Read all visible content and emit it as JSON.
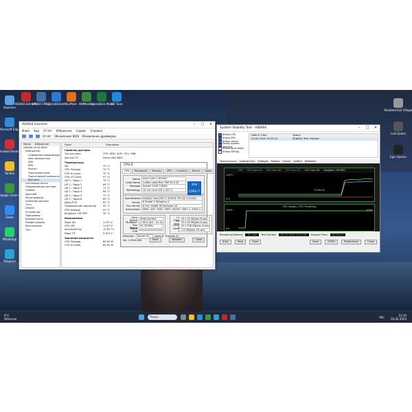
{
  "desktop": {
    "icons_left": [
      {
        "label": "Корзина",
        "color": "#5aa0e8"
      },
      {
        "label": "Microsoft Edge",
        "color": "#2e8fd6"
      },
      {
        "label": "Acrobat Reader",
        "color": "#d32f2f"
      },
      {
        "label": "Yandex",
        "color": "#f0c020"
      },
      {
        "label": "Google Chrome",
        "color": "#3c9a3c"
      },
      {
        "label": "Zoom",
        "color": "#2d8cff"
      },
      {
        "label": "WhatsApp",
        "color": "#25d366"
      },
      {
        "label": "Telegram",
        "color": "#2aa3d8"
      }
    ],
    "icons_top": [
      {
        "label": "AIDA64 Extreme",
        "color": "#c62828"
      },
      {
        "label": "CPUID CPU-Z",
        "color": "#4a6fa5"
      },
      {
        "label": "CrystalDiskInfo",
        "color": "#2b7bd6"
      },
      {
        "label": "FurMark",
        "color": "#e07020"
      },
      {
        "label": "HWMonitor",
        "color": "#3a8a3a"
      },
      {
        "label": "CrystalDisk Mark",
        "color": "#1b7a3e"
      },
      {
        "label": "HD Tune",
        "color": "#1e88e5"
      }
    ],
    "icons_right": [
      {
        "label": "Resident Evil Village",
        "color": "#999999"
      },
      {
        "label": "Last Epoch",
        "color": "#555555"
      },
      {
        "label": "Epic Games",
        "color": "#222222"
      }
    ]
  },
  "aida": {
    "title": "AIDA64 Extreme",
    "menu": [
      "Файл",
      "Вид",
      "Отчёт",
      "Избранное",
      "Сервис",
      "Справка"
    ],
    "toolbar": [
      "Отчёт",
      "Обновления BIOS",
      "Обновление драйверов"
    ],
    "tree_header": [
      "Меню",
      "Избранное"
    ],
    "tree": [
      "AIDA64 v6.92.6600",
      "Компьютер",
      "Суммарная информация",
      "Имя компьютера",
      "DMI",
      "IPMI",
      "Разгон",
      "Электропитание",
      "Портативный компьютер",
      "Датчики",
      "Системная плата",
      "Операционная система",
      "Сервер",
      "Дисплей",
      "Мультимедиа",
      "Хранение данных",
      "Сеть",
      "DirectX",
      "Устройства",
      "Программы",
      "Безопасность",
      "Конфигурация",
      "База данных",
      "Тест"
    ],
    "columns": [
      "Поле",
      "Значение"
    ],
    "rows": [
      {
        "k": "Свойства датчика",
        "v": "",
        "sec": true
      },
      {
        "k": "Тип датчика",
        "v": "CPU, HDD, ACPI, PCH, SNB"
      },
      {
        "k": "Датчик ГП",
        "v": "Driver (NV-DRV)"
      },
      {
        "k": "Температуры",
        "v": "",
        "sec": true
      },
      {
        "k": "ЦП",
        "v": "75 °C"
      },
      {
        "k": "CPU Package",
        "v": "75 °C"
      },
      {
        "k": "CPU IA Cores",
        "v": "75 °C"
      },
      {
        "k": "CPU GT Cores",
        "v": "57 °C"
      },
      {
        "k": "ЦП 1 / Ядро 1",
        "v": "75 °C"
      },
      {
        "k": "ЦП 1 / Ядро 2",
        "v": "69 °C"
      },
      {
        "k": "ЦП 1 / Ядро 3",
        "v": "71 °C"
      },
      {
        "k": "ЦП 1 / Ядро 4",
        "v": "64 °C"
      },
      {
        "k": "ЦП 1 / Ядро 5",
        "v": "71 °C"
      },
      {
        "k": "ЦП 1 / Ядро 6",
        "v": "69 °C"
      },
      {
        "k": "Диод PCH",
        "v": "62 °C"
      },
      {
        "k": "Графический процессор",
        "v": "45 °C"
      },
      {
        "k": "GPU Hotspot",
        "v": "53 °C"
      },
      {
        "k": "KingSpec 1TB PRO",
        "v": "30 °C"
      },
      {
        "k": "Напряжения",
        "v": "",
        "sec": true
      },
      {
        "k": "Ядро ЦП",
        "v": "1.007 V"
      },
      {
        "k": "CPU VID",
        "v": "1.007 V"
      },
      {
        "k": "Аккумулятор",
        "v": "12.877 V"
      },
      {
        "k": "Ядро ГП",
        "v": "0.613 V"
      },
      {
        "k": "Значения мощности",
        "v": "",
        "sec": true
      },
      {
        "k": "CPU Package",
        "v": "89.00 W"
      },
      {
        "k": "CPU IA Cores",
        "v": "85.92 W"
      }
    ]
  },
  "cpuz": {
    "title": "CPU-Z",
    "tabs": [
      "CPU",
      "Mainboard",
      "Memory",
      "SPD",
      "Graphics",
      "Bench",
      "About"
    ],
    "processor": [
      {
        "l": "Name",
        "v": "Intel Core i7 8750H"
      },
      {
        "l": "Code Name",
        "v": "Coffee Lake   Max TDP 45.0 W"
      },
      {
        "l": "Package",
        "v": "Socket 1440 FCBGA"
      },
      {
        "l": "Technology",
        "v": "14 nm   Core VID 1.007 V"
      }
    ],
    "spec": "Intel(R) Core(TM) i7-8750H CPU @ 2.20GHz",
    "family": [
      {
        "l": "Family",
        "v": "6   Model 9   Stepping A"
      },
      {
        "l": "Ext. Family",
        "v": "6   Ext. Model 9E   Revision U0"
      },
      {
        "l": "Instructions",
        "v": "MMX, SSE, SSE2, SSE3, SSSE3, SSE4.1, SSE4.2, EM64T, VT-x, AES, AVX, AVX2, FMA3"
      }
    ],
    "clocks": [
      {
        "l": "Core Speed",
        "v": "3585.48 MHz"
      },
      {
        "l": "Multiplier",
        "v": "x 36.0 (8.0 - 41.0)"
      },
      {
        "l": "Bus Speed",
        "v": "99.78 MHz"
      },
      {
        "l": "Rated FSB",
        "v": ""
      }
    ],
    "cache": [
      {
        "l": "L1 Data",
        "v": "6 x 32 KBytes   8-way"
      },
      {
        "l": "L1 Inst.",
        "v": "6 x 32 KBytes   8-way"
      },
      {
        "l": "Level 2",
        "v": "6 x 256 KBytes   4-way"
      },
      {
        "l": "Level 3",
        "v": "12 MBytes   16-way"
      }
    ],
    "selection": "Socket #1",
    "cores": "Cores 6",
    "threads": "Threads 12",
    "version": "Ver. 2.08.0.x64",
    "tools": "Tools",
    "validate": "Validate",
    "close": "Close",
    "intel_badge": "intel CORE i7"
  },
  "sst": {
    "title": "System Stability Test - AIDA64",
    "checks": [
      "Stress CPU",
      "Stress FPU",
      "Stress cache",
      "Stress system memory",
      "Stress local disks",
      "Stress GPU(s)"
    ],
    "log_head": [
      "Date & Time",
      "Status"
    ],
    "log_row": [
      "03.02.2024 13:05:24",
      "Stability Test: Started"
    ],
    "tabs": [
      "Temperatures",
      "Cooling Fans",
      "Voltages",
      "Powers",
      "Clocks",
      "Unified",
      "Statistics"
    ],
    "graph1_legend": [
      "CPU",
      "CPU Core #1",
      "CPU Core #2",
      "CPU Core #3",
      "CPU Core #4",
      "KingSpec 1TB PRO"
    ],
    "graph1_top": "100°C",
    "graph1_bottom": "0°C",
    "graph1_time": "13:05:24",
    "graph2_title": "CPU Usage | CPU Throttling",
    "graph2_top": "100%",
    "graph2_bottom": "0%",
    "graph2_right": "100%",
    "remaining_label": "Remaining Battery:",
    "remaining_value": "AC Line",
    "started_label": "Test Started:",
    "started_value": "03.02.2024 13:05:24",
    "elapsed_label": "Elapsed Time:",
    "elapsed_value": "00:04:44",
    "buttons": [
      "Start",
      "Stop",
      "Clear",
      "Save",
      "CPUID",
      "Preferences",
      "Close"
    ]
  },
  "taskbar": {
    "weather_temp": "0°C",
    "weather_text": "Облачно",
    "search": "Поиск",
    "lang": "РУС",
    "time": "13:10",
    "date": "03.02.2024"
  }
}
